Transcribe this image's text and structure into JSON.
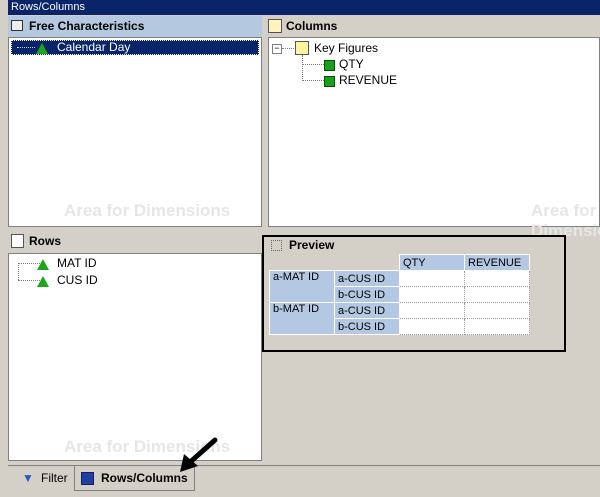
{
  "window": {
    "title": "Rows/Columns"
  },
  "free_characteristics": {
    "title": "Free Characteristics",
    "items": [
      {
        "label": "Calendar Day",
        "selected": true
      }
    ],
    "watermark": "Area for Dimensions"
  },
  "columns": {
    "title": "Columns",
    "root": "Key Figures",
    "items": [
      {
        "label": "QTY"
      },
      {
        "label": "REVENUE"
      }
    ],
    "watermark": "Area for Dimensions"
  },
  "rows": {
    "title": "Rows",
    "items": [
      {
        "label": "MAT ID"
      },
      {
        "label": "CUS ID"
      }
    ],
    "watermark": "Area for Dimensions"
  },
  "preview": {
    "title": "Preview",
    "col_headers": [
      "QTY",
      "REVENUE"
    ],
    "groups": [
      {
        "label": "a-MAT ID",
        "subs": [
          "a-CUS ID",
          "b-CUS ID"
        ]
      },
      {
        "label": "b-MAT ID",
        "subs": [
          "a-CUS ID",
          "b-CUS ID"
        ]
      }
    ]
  },
  "tabs": [
    {
      "label": "Filter",
      "active": false
    },
    {
      "label": "Rows/Columns",
      "active": true
    }
  ],
  "colors": {
    "title_bar": "#0a246a",
    "selection": "#0a246a",
    "header_blue": "#b4c8e4"
  }
}
